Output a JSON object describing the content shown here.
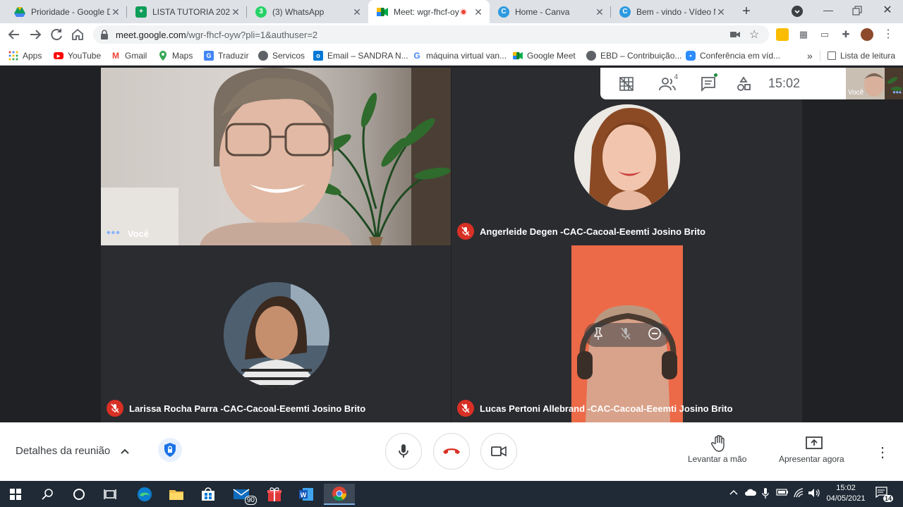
{
  "browser": {
    "tabs": [
      {
        "title": "Prioridade - Google Dr",
        "icon": "google-drive-icon",
        "active": false
      },
      {
        "title": "LISTA TUTORIA 2021.x",
        "icon": "google-sheets-icon",
        "active": false
      },
      {
        "title": "(3) WhatsApp",
        "icon": "whatsapp-icon",
        "badge": "3",
        "active": false
      },
      {
        "title": "Meet: wgr-fhcf-oy",
        "icon": "google-meet-icon",
        "active": true,
        "recording": true
      },
      {
        "title": "Home - Canva",
        "icon": "canva-icon",
        "active": false
      },
      {
        "title": "Bem - vindo - Vídeo M",
        "icon": "canva-icon",
        "active": false
      }
    ],
    "url_host": "meet.google.com",
    "url_path": "/wgr-fhcf-oyw?pli=1&authuser=2",
    "bookmarks": [
      {
        "label": "Apps",
        "icon": "apps-grid-icon"
      },
      {
        "label": "YouTube",
        "icon": "youtube-icon"
      },
      {
        "label": "Gmail",
        "icon": "gmail-icon"
      },
      {
        "label": "Maps",
        "icon": "maps-icon"
      },
      {
        "label": "Traduzir",
        "icon": "translate-icon"
      },
      {
        "label": "Servicos",
        "icon": "globe-icon"
      },
      {
        "label": "Email – SANDRA N...",
        "icon": "outlook-icon"
      },
      {
        "label": "máquina virtual van...",
        "icon": "google-icon"
      },
      {
        "label": "Google Meet",
        "icon": "google-meet-icon"
      },
      {
        "label": "EBD – Contribuição...",
        "icon": "globe-icon"
      },
      {
        "label": "Conferência em víd...",
        "icon": "zoom-icon"
      }
    ],
    "overflow": "»",
    "reading_list": "Lista de leitura"
  },
  "meet": {
    "info_bar": {
      "participants_count": "4",
      "time": "15:02"
    },
    "self_thumb_label": "Você",
    "tiles": [
      {
        "name": "Você",
        "muted": false
      },
      {
        "name": "Angerleide Degen -CAC-Cacoal-Eeemti Josino Brito",
        "muted": true
      },
      {
        "name": "Larissa Rocha Parra -CAC-Cacoal-Eeemti Josino Brito",
        "muted": true
      },
      {
        "name": "Lucas Pertoni Allebrand -CAC-Cacoal-Eeemti Josino Brito",
        "muted": true
      }
    ],
    "controls": {
      "details_label": "Detalhes da reunião",
      "raise_hand_label": "Levantar a mão",
      "present_label": "Apresentar agora"
    }
  },
  "taskbar": {
    "mail_badge": "90",
    "clock_time": "15:02",
    "clock_date": "04/05/2021",
    "notifications": "14"
  },
  "colors": {
    "meet_bg": "#202124",
    "hangup_red": "#d93025",
    "active_blue": "#1a73e8"
  }
}
